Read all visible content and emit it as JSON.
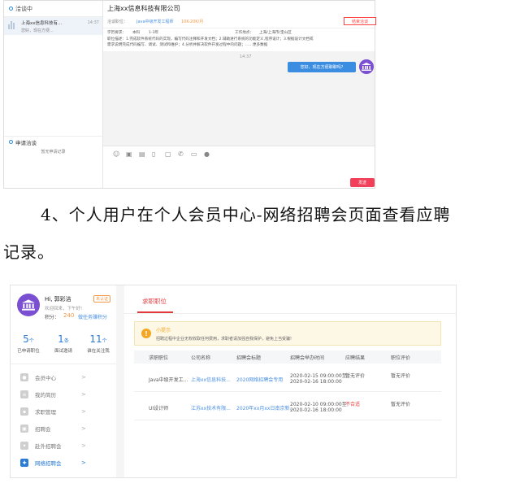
{
  "chat": {
    "sidebar_title": "洽谈中",
    "conversation": {
      "title": "上海xx信息科技有...",
      "time": "14:37",
      "preview": "您好，现在方便..."
    },
    "apply_title": "申请洽谈",
    "apply_empty": "暂无申请记录",
    "company": "上海xx信息科技有限公司",
    "position_label": "洽谈职位：",
    "position_name": "Java中级开发工程师",
    "salary": "10K-20K/月",
    "cancel_button": "结束洽谈",
    "edu_label": "学历要求：",
    "edu_value": "本科",
    "exp_value": "1-3年",
    "location_label": "工作地点：",
    "location_value": "上海/上海市/宝山区",
    "desc_line1": "职位描述：1.完成软件系统代码的实现，编写代码注释和开发文档；2.辅助进行系统的功能定义,程序设计；3.根据设计文档或",
    "desc_line2": "需求说明完成代码编写、调试、测试和维护；4.分析并解决软件开发过程中的问题；……更多数据",
    "message_time": "14:37",
    "message_text": "您好，现在方便聊聊吗?",
    "send_button": "发送"
  },
  "step_text_line1": "4、个人用户在个人会员中心-网络招聘会页面查看应聘",
  "step_text_line2": "记录。",
  "member": {
    "greeting": "Hi, 郭彩洁",
    "auth_tag": "未认证",
    "welcome": "欢迎回来，下午好!",
    "points_label": "积分：",
    "points_value": "240",
    "points_link": "做任务赚积分",
    "stats": [
      {
        "num": "5",
        "unit": "个",
        "label": "已申请职位"
      },
      {
        "num": "1",
        "unit": "条",
        "label": "面试邀请"
      },
      {
        "num": "11",
        "unit": "个",
        "label": "谁在关注我"
      }
    ],
    "menu": [
      "会员中心",
      "我的简历",
      "求职管理",
      "招聘会",
      "赴外招聘会",
      "网络招聘会"
    ]
  },
  "panel": {
    "tab": "求职职位",
    "tip_title": "小提示",
    "tip_text": "招聘过程中企业无权收取任何费用，求职者请加强自我保护，避免上当受骗!",
    "columns": [
      "求职职位",
      "公司名称",
      "招聘会标题",
      "招聘会举办时间",
      "应聘结果",
      "职位评价"
    ],
    "rows": [
      {
        "position": "Java中级开发工...",
        "company": "上海xx信息科技...",
        "fair": "2020网络招聘会专用",
        "time1": "2020-02-15 09:00:00至",
        "time2": "2020-02-16 18:00:00",
        "result": "暂无评价",
        "rating": "暂无评价"
      },
      {
        "position": "UI设计师",
        "company": "江苏xx技术有限...",
        "fair": "2020年xx月xx日南京新...",
        "time1": "2020-02-10 09:00:00至",
        "time2": "2020-02-16 18:00:00",
        "result": "不合适",
        "rating": "暂无评价"
      }
    ]
  }
}
